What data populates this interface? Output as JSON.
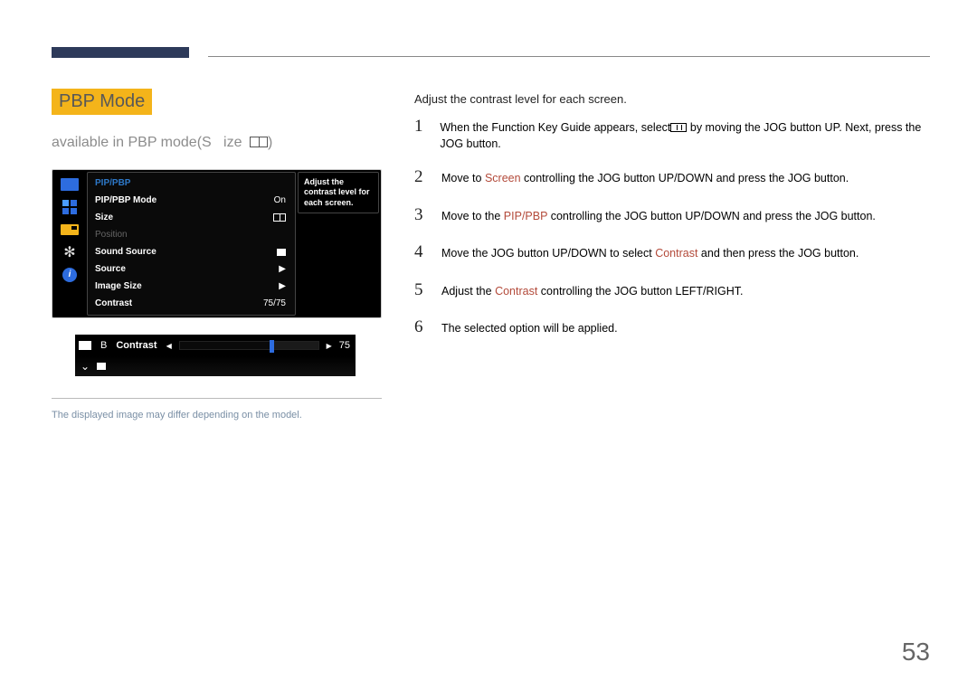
{
  "header": {
    "section_title": "PBP Mode",
    "subtitle_prefix": "available in PBP mode(",
    "subtitle_s": "S",
    "subtitle_ize": "ize",
    "subtitle_suffix": ")"
  },
  "osd": {
    "title": "PIP/PBP",
    "tooltip": "Adjust the contrast level for each screen.",
    "rows": {
      "mode": {
        "label": "PIP/PBP Mode",
        "value": "On"
      },
      "size": {
        "label": "Size"
      },
      "position": {
        "label": "Position"
      },
      "sound_source": {
        "label": "Sound Source"
      },
      "source": {
        "label": "Source"
      },
      "image_size": {
        "label": "Image Size"
      },
      "contrast": {
        "label": "Contrast",
        "value": "75/75"
      }
    }
  },
  "slider": {
    "letter": "B",
    "label": "Contrast",
    "value": "75"
  },
  "footnote": "The displayed image may differ depending on the model.",
  "right": {
    "lead": "Adjust the contrast level for each screen.",
    "steps": {
      "s1_a": "When the Function Key Guide appears, s",
      "s1_b": "elect",
      "s1_c": " by moving the JOG button UP. Next, press the JOG button.",
      "s2_a": "Move to ",
      "s2_screen": "Screen",
      "s2_b": " controlling the JOG button UP/DOWN and press the JOG button.",
      "s3_a": "Move to the ",
      "s3_pip": "PIP/PBP",
      "s3_b": " controlling the JOG button UP/DOWN and press the JOG button.",
      "s4_a": "Move the JOG button UP/DOWN to select ",
      "s4_contrast": "Contrast",
      "s4_b": " and then press the JOG button.",
      "s5_a": "Adjust the ",
      "s5_contrast": "Contrast",
      "s5_b": " controlling the JOG button LEFT/RIGHT.",
      "s6": "The selected option will be applied."
    }
  },
  "page_number": "53"
}
